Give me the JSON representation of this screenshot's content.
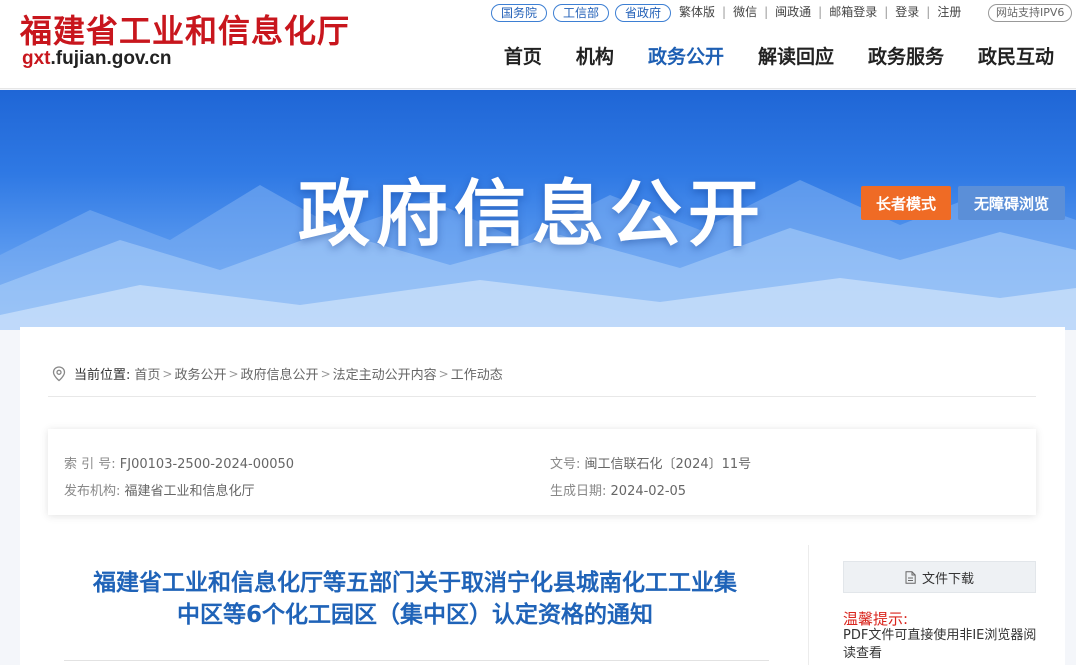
{
  "site": {
    "name_cn": "福建省工业和信息化厅",
    "domain_prefix": "gxt",
    "domain_rest": ".fujian.gov.cn",
    "brand_color": "#c8161d"
  },
  "top_tags": [
    "国务院",
    "工信部",
    "省政府"
  ],
  "top_links": [
    "繁体版",
    "微信",
    "闽政通",
    "邮箱登录",
    "登录",
    "注册"
  ],
  "ipv6_badge": "网站支持IPV6",
  "nav": {
    "items": [
      "首页",
      "机构",
      "政务公开",
      "解读回应",
      "政务服务",
      "政民互动"
    ],
    "active_index": 2,
    "active_color": "#1e5fb3"
  },
  "banner": {
    "title": "政府信息公开",
    "elder_mode": "长者模式",
    "accessible": "无障碍浏览"
  },
  "breadcrumb": {
    "label": "当前位置:",
    "items": [
      "首页",
      "政务公开",
      "政府信息公开",
      "法定主动公开内容",
      "工作动态"
    ]
  },
  "meta": {
    "index_label": "索 引 号:",
    "index_value": "FJ00103-2500-2024-00050",
    "docno_label": "文号:",
    "docno_value": "闽工信联石化〔2024〕11号",
    "publisher_label": "发布机构:",
    "publisher_value": "福建省工业和信息化厅",
    "date_label": "生成日期:",
    "date_value": "2024-02-05"
  },
  "document": {
    "title_line1": "福建省工业和信息化厅等五部门关于取消宁化县城南化工工业集",
    "title_line2": "中区等6个化工园区（集中区）认定资格的通知"
  },
  "sidebar": {
    "download_label": "文件下载",
    "tip_title": "温馨提示:",
    "tip_text": "PDF文件可直接使用非IE浏览器阅读查看"
  }
}
